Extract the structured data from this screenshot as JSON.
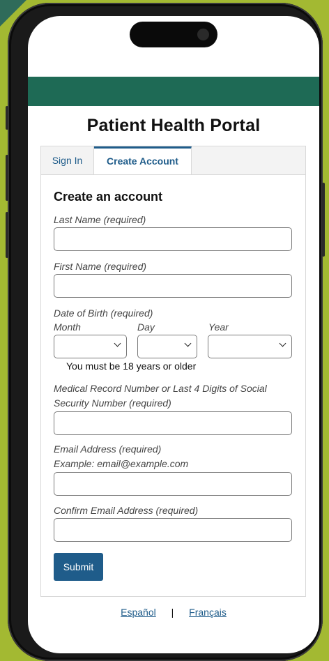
{
  "portal": {
    "title": "Patient Health Portal"
  },
  "tabs": [
    {
      "label": "Sign In",
      "active": false
    },
    {
      "label": "Create Account",
      "active": true
    }
  ],
  "form": {
    "heading": "Create an account",
    "last_name_label": "Last Name (required)",
    "last_name_value": "",
    "first_name_label": "First Name (required)",
    "first_name_value": "",
    "dob_label": "Date of Birth (required)",
    "month_label": "Month",
    "day_label": "Day",
    "year_label": "Year",
    "month_value": "",
    "day_value": "",
    "year_value": "",
    "age_note": "You must be 18 years or older",
    "mrn_label": "Medical Record Number or Last 4 Digits of Social Security Number (required)",
    "mrn_value": "",
    "email_label": "Email Address (required)",
    "email_example": "Example: email@example.com",
    "email_value": "",
    "confirm_email_label": "Confirm Email Address (required)",
    "confirm_email_value": "",
    "submit_label": "Submit"
  },
  "languages": {
    "spanish": "Español",
    "separator": "|",
    "french": "Français"
  },
  "colors": {
    "header": "#1e6a55",
    "accent": "#1f5c8a",
    "background": "#a3b932"
  }
}
